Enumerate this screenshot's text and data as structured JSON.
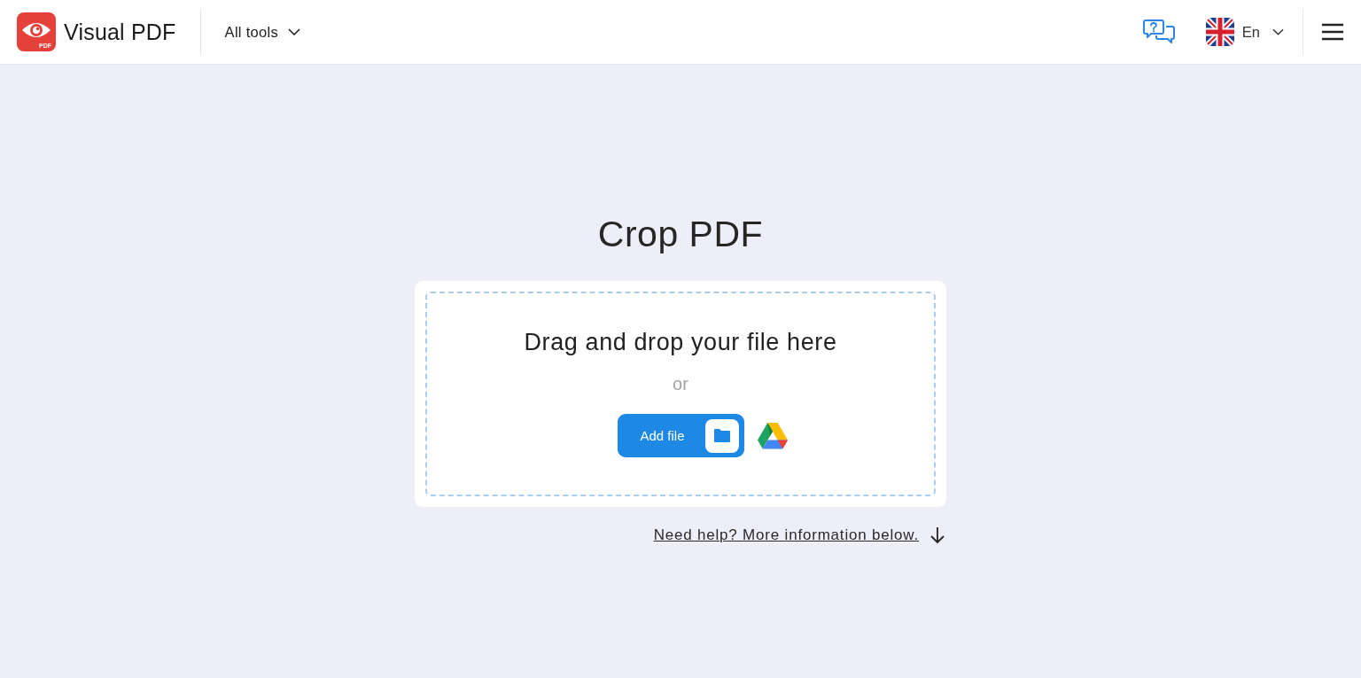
{
  "header": {
    "logo": {
      "badge": "PDF",
      "name": "Visual PDF"
    },
    "menu": {
      "label": "All tools"
    },
    "language": {
      "label": "En"
    }
  },
  "main": {
    "title": "Crop PDF",
    "dropzone": {
      "prompt": "Drag and drop your file here",
      "separator": "or",
      "button": "Add file"
    },
    "help_link": "Need help? More information below."
  }
}
